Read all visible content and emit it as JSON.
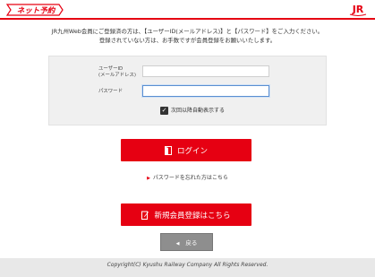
{
  "header": {
    "logo_text": "ネット予約",
    "jr_logo_text": "JR",
    "brand_color": "#e60012"
  },
  "intro": {
    "line1": "JR九州Web会員にご登録済の方は、【ユーザーID(メールアドレス)】と【パスワード】をご入力ください。",
    "line2": "登録されていない方は、お手数ですが会員登録をお願いいたします。"
  },
  "form": {
    "user_label_line1": "ユーザーID",
    "user_label_line2": "(メールアドレス)",
    "user_value": "",
    "password_label": "パスワード",
    "password_value": "",
    "auto_display_label": "次回以降自動表示する",
    "auto_display_checked": true
  },
  "buttons": {
    "login_label": "ログイン",
    "forgot_password_label": "パスワードを忘れた方はこちら",
    "register_label": "新規会員登録はこちら",
    "back_label": "戻る"
  },
  "icons": {
    "login": "door-enter-icon",
    "register": "edit-form-icon",
    "forgot": "arrow-right-icon",
    "back": "arrow-left-icon",
    "checkbox": "checkmark-icon"
  },
  "footer": {
    "copyright": "Copyright(C) Kyushu Railway Company All Rights Reserved."
  }
}
